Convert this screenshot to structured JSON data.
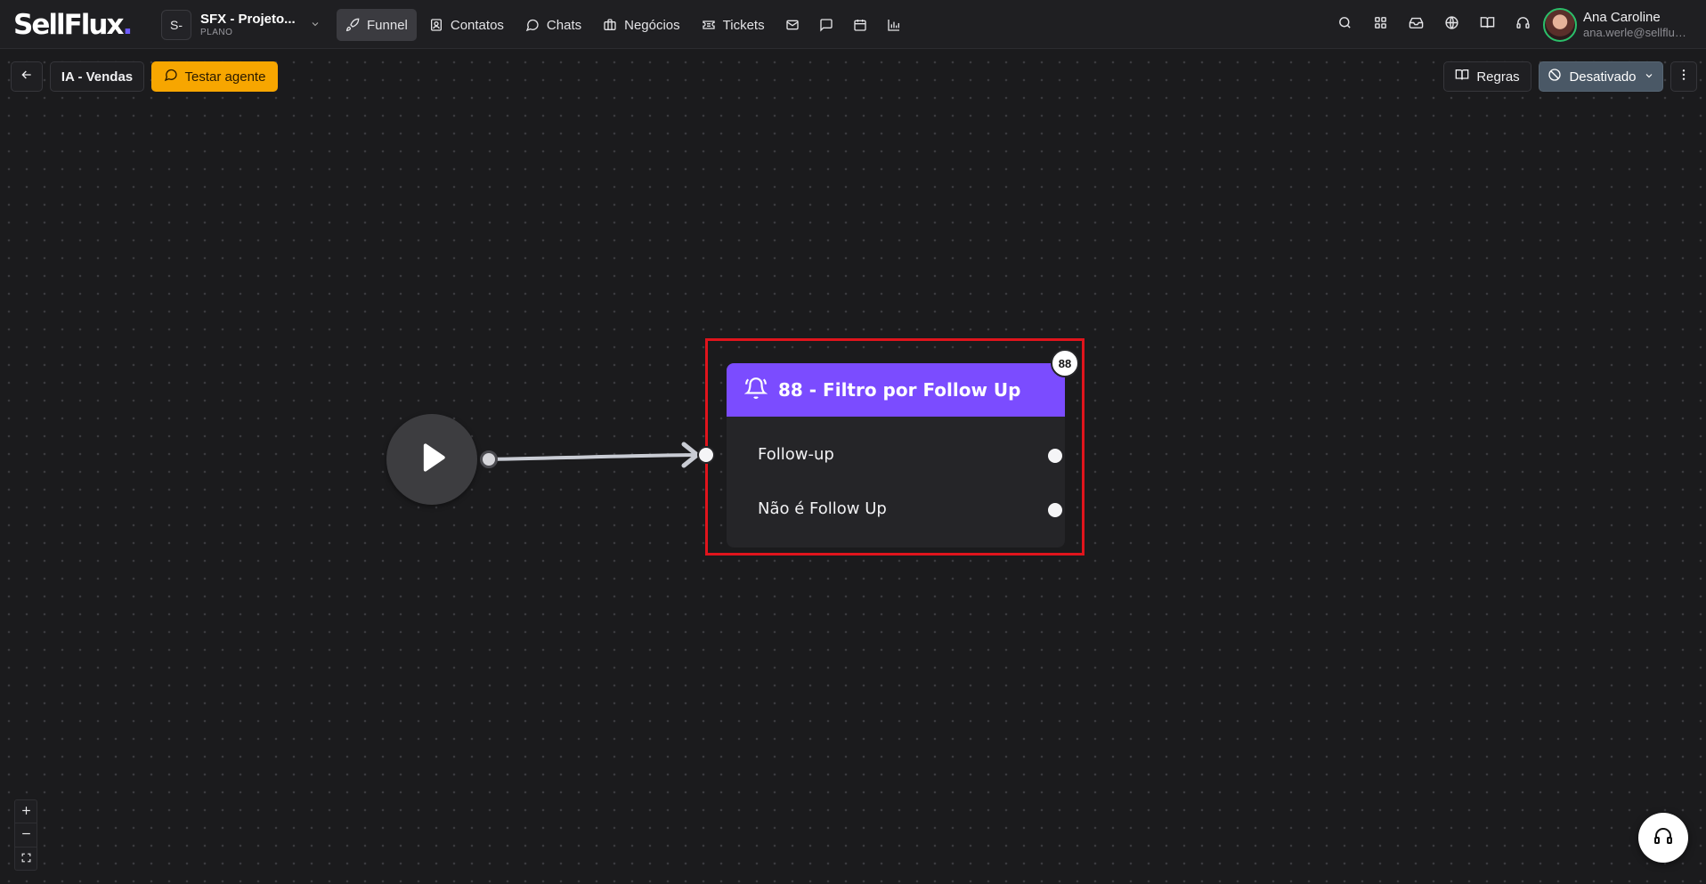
{
  "brand": {
    "logo_text": "SellFlux",
    "logo_dot": "."
  },
  "workspace": {
    "badge": "S-",
    "name": "SFX - Projeto...",
    "plan": "PLANO"
  },
  "nav": {
    "items": [
      {
        "label": "Funnel",
        "icon": "rocket-icon",
        "active": true
      },
      {
        "label": "Contatos",
        "icon": "contacts-icon"
      },
      {
        "label": "Chats",
        "icon": "chat-bubble-icon"
      },
      {
        "label": "Negócios",
        "icon": "briefcase-icon"
      },
      {
        "label": "Tickets",
        "icon": "ticket-icon"
      }
    ],
    "icon_only": [
      "mail-icon",
      "message-square-icon",
      "calendar-icon",
      "bar-chart-icon"
    ]
  },
  "header_right": {
    "icons": [
      "search-icon",
      "apps-grid-icon",
      "inbox-icon",
      "globe-icon",
      "book-icon",
      "headset-icon"
    ]
  },
  "user": {
    "name": "Ana Caroline",
    "email": "ana.werle@sellflux..."
  },
  "toolbar": {
    "flow_name": "IA - Vendas",
    "test_agent": "Testar agente",
    "rules": "Regras",
    "status": "Desativado"
  },
  "node": {
    "title": "88 - Filtro por Follow Up",
    "badge": "88",
    "options": [
      "Follow-up",
      "Não é Follow Up"
    ],
    "header_color": "#7b4cff"
  },
  "colors": {
    "accent": "#7b4cff",
    "test_button": "#f7a600",
    "status_button": "#4a5866",
    "highlight": "#e0141c"
  }
}
